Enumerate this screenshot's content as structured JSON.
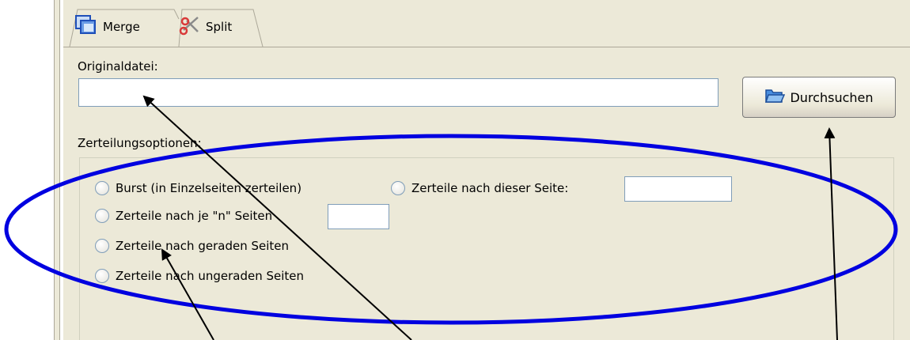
{
  "tabs": [
    {
      "label": "Merge",
      "icon": "merge-icon"
    },
    {
      "label": "Split",
      "icon": "scissors-icon"
    }
  ],
  "file": {
    "label": "Originaldatei:",
    "value": "",
    "browse_label": "Durchsuchen",
    "browse_icon": "folder-icon"
  },
  "options": {
    "label": "Zerteilungsoptionen:",
    "burst": "Burst (in Einzelseiten zerteilen)",
    "after_page": "Zerteile nach dieser Seite:",
    "every_n": "Zerteile nach je \"n\" Seiten",
    "even": "Zerteile nach geraden Seiten",
    "odd": "Zerteile nach ungeraden Seiten"
  },
  "annotation": {
    "ellipse_color": "#0000e0",
    "arrow_color": "#000000"
  }
}
